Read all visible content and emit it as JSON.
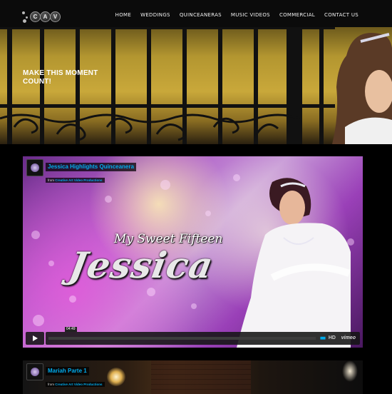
{
  "nav": {
    "logo_letters": [
      "C",
      "A",
      "V"
    ],
    "items": [
      {
        "label": "HOME"
      },
      {
        "label": "WEDDINGS"
      },
      {
        "label": "QUINCEANERAS"
      },
      {
        "label": "MUSIC VIDEOS"
      },
      {
        "label": "COMMERCIAL"
      },
      {
        "label": "CONTACT US"
      }
    ]
  },
  "hero": {
    "title_line1": "MAKE THIS MOMENT",
    "title_line2": "COUNT!"
  },
  "video1": {
    "title": "Jessica Highlights Quinceanera",
    "from_prefix": "from",
    "from_name": "Creative Art Video Productions",
    "overlay_subtitle": "My Sweet Fifteen",
    "overlay_name": "Jessica",
    "time": "04:49",
    "hd": "HD",
    "brand": "vimeo"
  },
  "video2": {
    "title": "Mariah Parte 1",
    "from_prefix": "from",
    "from_name": "Creative Art Video Productions"
  },
  "colors": {
    "accent": "#00adef",
    "nav_bg": "#0b0b0b",
    "hero_gold": "#c9a83a"
  }
}
